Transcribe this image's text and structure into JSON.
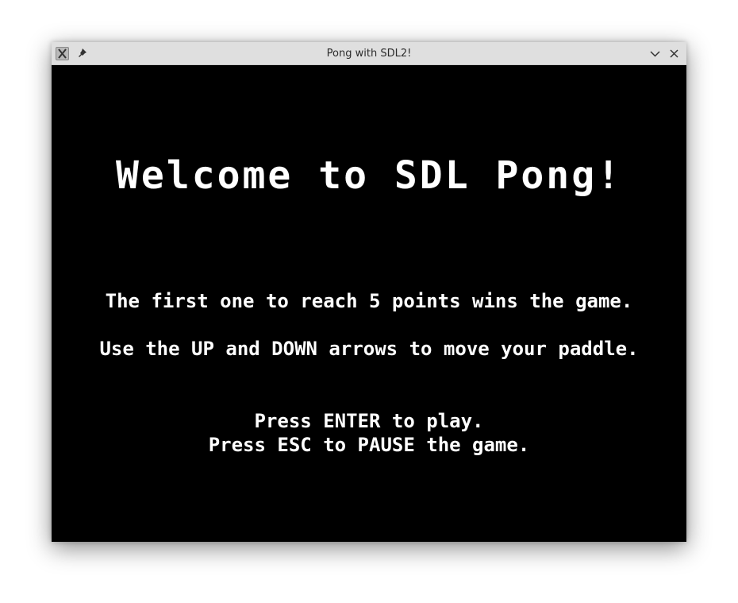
{
  "window": {
    "title": "Pong with SDL2!",
    "icons": {
      "app": "app-x-icon",
      "pin": "pin-icon",
      "minimize": "chevron-down-icon",
      "close": "close-icon"
    }
  },
  "game": {
    "welcome": "Welcome to SDL Pong!",
    "rule_points": "The first one to reach 5 points wins the game.",
    "rule_controls": "Use the UP and DOWN arrows to move your paddle.",
    "press_enter": "Press ENTER to play.",
    "press_esc": "Press ESC to PAUSE the game."
  },
  "colors": {
    "background": "#000000",
    "text": "#ffffff",
    "titlebar": "#dfdfdf"
  }
}
